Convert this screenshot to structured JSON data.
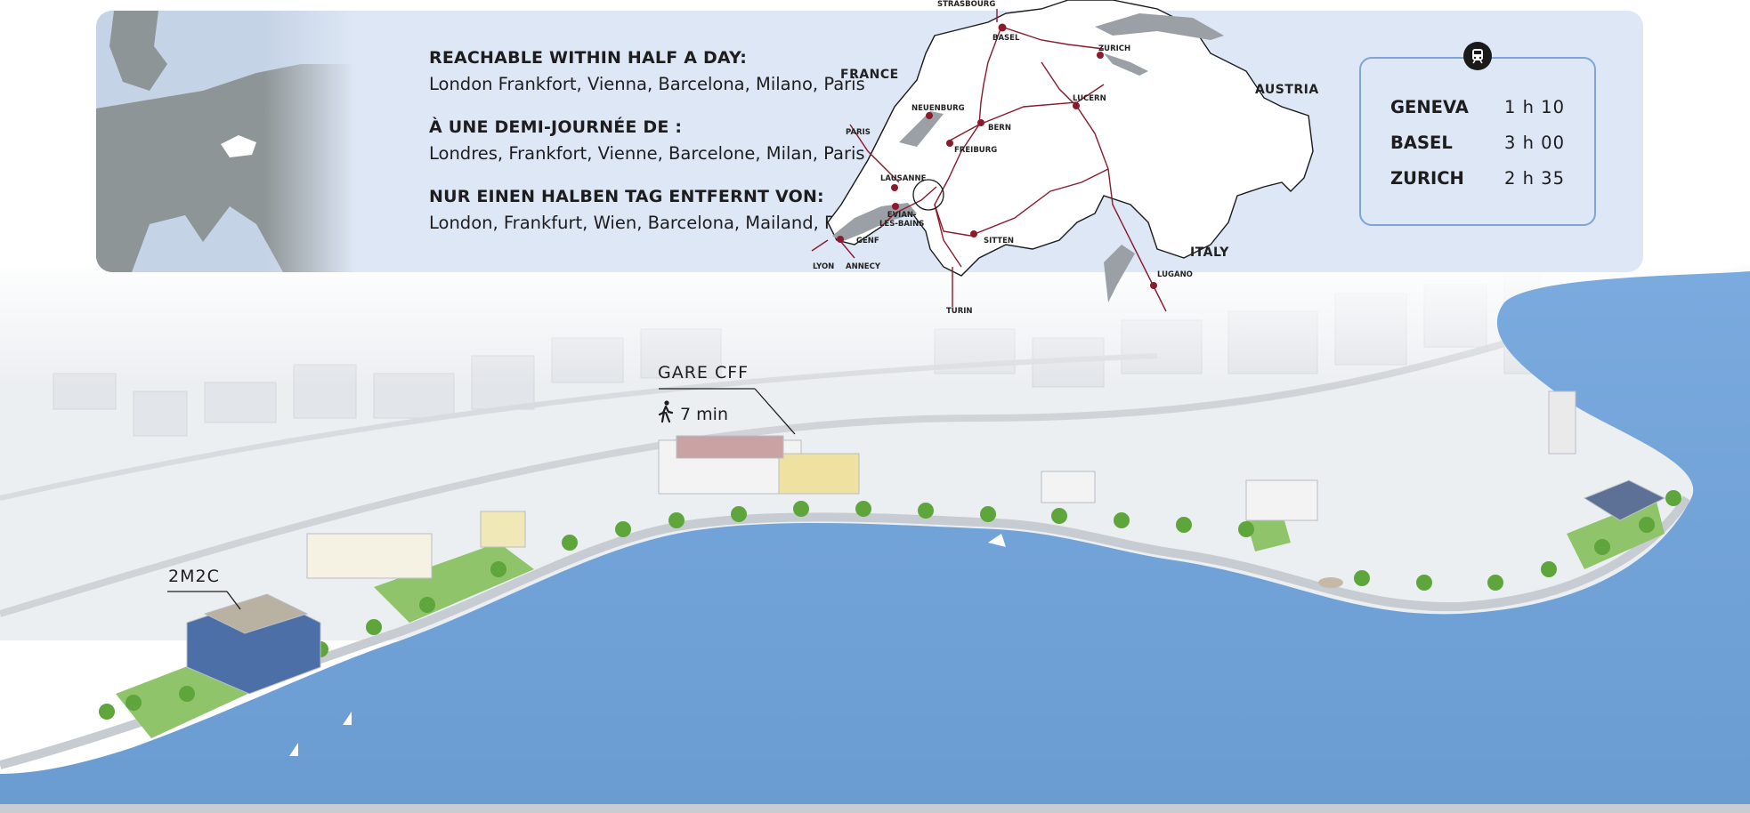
{
  "reach": {
    "en_heading": "REACHABLE WITHIN HALF A DAY:",
    "en_cities": "London Frankfort, Vienna, Barcelona, Milano, Paris",
    "fr_heading": "À UNE DEMI-JOURNÉE DE :",
    "fr_cities": "Londres, Frankfort, Vienne, Barcelone, Milan, Paris",
    "de_heading": "NUR EINEN HALBEN TAG ENTFERNT VON:",
    "de_cities": "London, Frankfurt, Wien, Barcelona, Mailand, Paris"
  },
  "train_times": {
    "icon": "train-icon",
    "rows": [
      {
        "city": "GENEVA",
        "time": "1 h  10"
      },
      {
        "city": "BASEL",
        "time": "3 h  00"
      },
      {
        "city": "ZURICH",
        "time": "2 h  35"
      }
    ]
  },
  "switzerland_map": {
    "countries": {
      "france": "FRANCE",
      "austria": "AUSTRIA",
      "italy": "ITALY"
    },
    "places": {
      "strasbourg": "STRASBOURG",
      "basel": "BASEL",
      "zurich": "ZURICH",
      "neuenburg": "NEUENBURG",
      "bern": "BERN",
      "lucern": "LUCERN",
      "paris": "PARIS",
      "freiburg": "FREIBURG",
      "lausanne": "LAUSANNE",
      "evian": "EVIAN-\nLES-BAINS",
      "genf": "GENF",
      "sitten": "SITTEN",
      "lyon": "LYON",
      "annecy": "ANNECY",
      "lugano": "LUGANO",
      "turin": "TURIN"
    },
    "colors": {
      "rail": "#8b1a2b",
      "lake": "#9aa0a6",
      "border": "#1a1a1a"
    }
  },
  "aerial": {
    "gare": "GARE CFF",
    "walk_icon": "walking-person-icon",
    "walk_time": "7 min",
    "venue": "2M2C",
    "colors": {
      "lake": "#6fa3d8",
      "panel": "#dde7f5"
    }
  }
}
